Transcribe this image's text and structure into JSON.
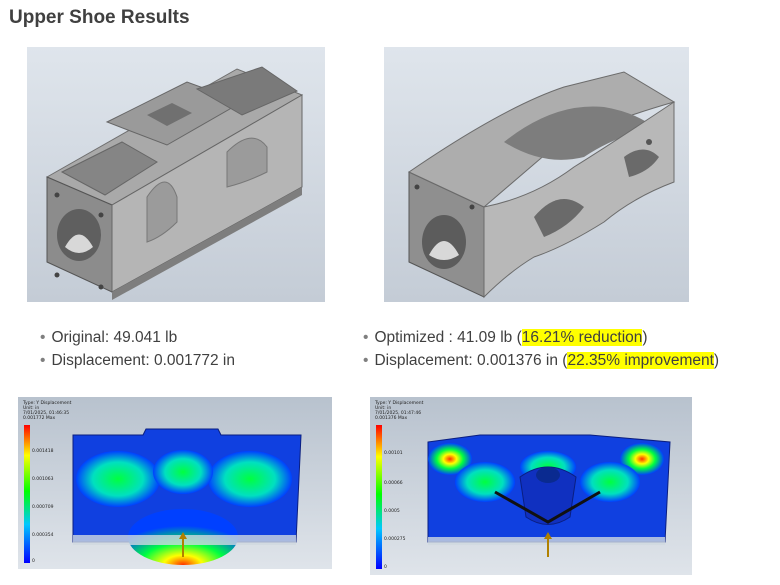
{
  "page": {
    "title": "Upper Shoe Results"
  },
  "left": {
    "bullets": [
      "Original: 49.041 lb",
      "Displacement: 0.001772 in"
    ],
    "fea": {
      "label": "Type: Y Displacement\nUnit: in\n7/01/2025, 01:46:35\n0.001772 Max",
      "ticks": [
        "0.001418",
        "0.001063",
        "0.000709",
        "0.000354",
        "0"
      ]
    }
  },
  "right": {
    "bullet1_prefix": "Optimized : 41.09 lb (",
    "bullet1_highlight": "16.21% reduction",
    "bullet1_suffix": ")",
    "bullet2_prefix": "Displacement: 0.001376 in (",
    "bullet2_highlight": "22.35% improvement",
    "bullet2_suffix": ")",
    "fea": {
      "label": "Type: Y Displacement\nUnit: in\n7/01/2025, 01:47:46\n0.001376 Max",
      "ticks": [
        "0.00101",
        "0.00066",
        "0.0005",
        "0.000275",
        "0"
      ]
    }
  },
  "colors": {
    "highlight": "#ffff00",
    "text": "#404040"
  },
  "bullet_glyph": "•"
}
